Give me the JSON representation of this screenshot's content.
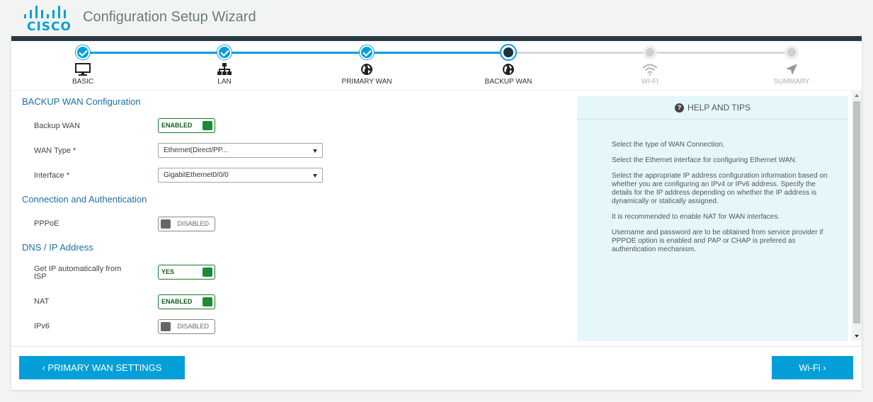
{
  "header": {
    "brand": "CISCO",
    "title": "Configuration Setup Wizard"
  },
  "stepper": {
    "steps": [
      {
        "label": "BASIC",
        "state": "done",
        "icon": "monitor-icon"
      },
      {
        "label": "LAN",
        "state": "done",
        "icon": "network-icon"
      },
      {
        "label": "PRIMARY WAN",
        "state": "done",
        "icon": "globe-icon"
      },
      {
        "label": "BACKUP WAN",
        "state": "current",
        "icon": "globe-icon"
      },
      {
        "label": "WI-FI",
        "state": "todo",
        "icon": "wifi-icon"
      },
      {
        "label": "SUMMARY",
        "state": "todo",
        "icon": "send-icon"
      }
    ],
    "accent": "#049fd9"
  },
  "form": {
    "section_backup": "BACKUP WAN Configuration",
    "backup_wan": {
      "label": "Backup WAN",
      "value": "ENABLED"
    },
    "wan_type": {
      "label": "WAN Type *",
      "value": "Ethernet(Direct/PP..."
    },
    "interface": {
      "label": "Interface *",
      "value": "GigabitEthernet0/0/0"
    },
    "section_conn": "Connection and Authentication",
    "pppoe": {
      "label": "PPPoE",
      "value": "DISABLED"
    },
    "section_dns": "DNS / IP Address",
    "get_ip": {
      "label_line1": "Get IP automatically from",
      "label_line2": "ISP",
      "value": "YES"
    },
    "nat": {
      "label": "NAT",
      "value": "ENABLED"
    },
    "ipv6": {
      "label": "IPv6",
      "value": "DISABLED"
    }
  },
  "help": {
    "title": "HELP AND TIPS",
    "tips": [
      "Select the type of WAN Connection.",
      "Select the Ethernet interface for configuring Ethernet WAN.",
      "Select the appropriate IP address configuration information based on whether you are configuring an IPv4 or IPv6 address. Specify the details for the IP address depending on whether the IP address is dynamically or statically assigned.",
      "It is recommended to enable NAT for WAN interfaces.",
      "Username and password are to be obtained from service provider if PPPOE option is enabled and PAP or CHAP is prefered as authentication mechanism."
    ]
  },
  "footer": {
    "back_label": "‹ PRIMARY WAN SETTINGS",
    "next_label": "Wi-Fi ›"
  }
}
